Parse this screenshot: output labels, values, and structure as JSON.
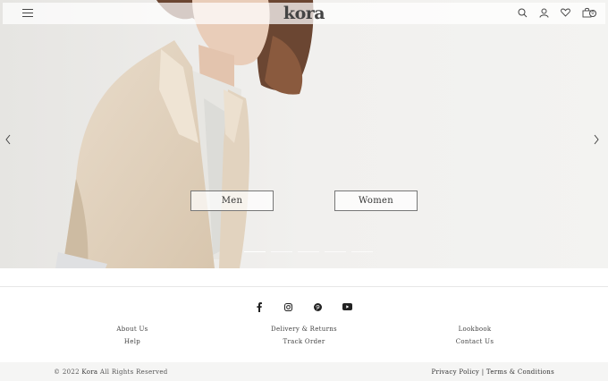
{
  "header": {
    "logo": "kora",
    "cart_count": "0"
  },
  "hero": {
    "buttons": {
      "men": "Men",
      "women": "Women"
    },
    "slides": 5,
    "active_slide": 1
  },
  "footer": {
    "social": [
      "facebook-icon",
      "instagram-icon",
      "pinterest-icon",
      "youtube-icon"
    ],
    "col1": [
      "About Us",
      "Help"
    ],
    "col2": [
      "Delivery & Returns",
      "Track Order"
    ],
    "col3": [
      "Lookbook",
      "Contact Us"
    ],
    "copyright_prefix": "© 2022",
    "brand": "Kora",
    "copyright_suffix": "All Rights Reserved",
    "privacy": "Privacy Policy",
    "separator": "|",
    "terms": "Terms & Conditions"
  }
}
